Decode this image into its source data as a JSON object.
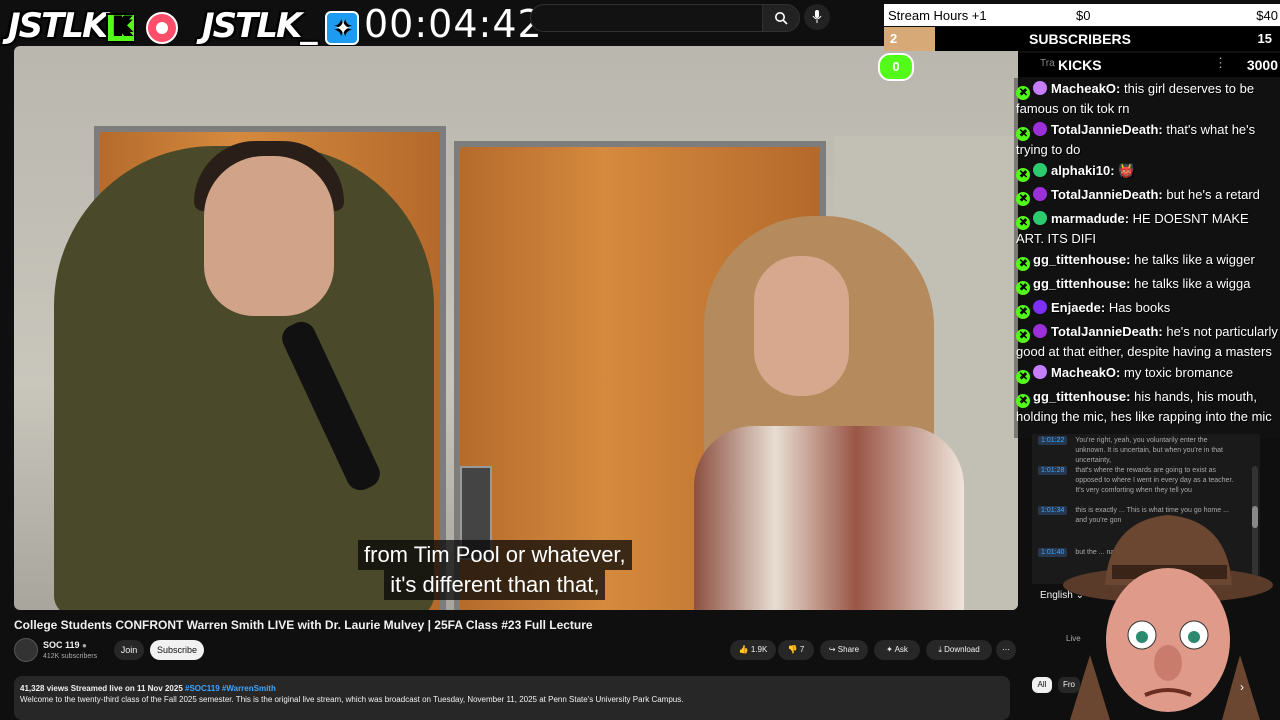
{
  "overlay": {
    "logo1": "JSTLK",
    "logo1_badge": "K",
    "logo2": "JSTLK_",
    "timer": "00:04:42",
    "stream_hours_label": "Stream Hours +1",
    "stream_hours_min": "$0",
    "stream_hours_max": "$40",
    "subs_current": "2",
    "subs_label": "SUBSCRIBERS",
    "subs_goal": "15",
    "subs_progress": 0.13,
    "kicks_current": "0",
    "kicks_label": "KICKS",
    "kicks_goal": "3000",
    "kicks_tab_hint": "Tra"
  },
  "chat": {
    "messages": [
      {
        "user": "MacheakO:",
        "text": "this girl deserves to be famous on tik tok rn",
        "badge_color": "#c77dff"
      },
      {
        "user": "TotalJannieDeath:",
        "text": "that's what he's trying to do",
        "badge_color": "#9b30d9"
      },
      {
        "user": "alphaki10:",
        "text": "👹",
        "badge_color": "#2ecc71"
      },
      {
        "user": "TotalJannieDeath:",
        "text": "but he's a retard",
        "badge_color": "#9b30d9"
      },
      {
        "user": "marmadude:",
        "text": "HE DOESNT MAKE ART. ITS DIFI",
        "badge_color": "#2ecc71"
      },
      {
        "user": "gg_tittenhouse:",
        "text": "he talks like a wigger",
        "badge_color": ""
      },
      {
        "user": "gg_tittenhouse:",
        "text": "he talks like a wigga",
        "badge_color": ""
      },
      {
        "user": "Enjaede:",
        "text": "Has books",
        "badge_color": "#7b2ff7"
      },
      {
        "user": "TotalJannieDeath:",
        "text": "he's not particularly good at that either, despite having a masters",
        "badge_color": "#9b30d9"
      },
      {
        "user": "MacheakO:",
        "text": "my toxic bromance",
        "badge_color": "#c77dff"
      },
      {
        "user": "gg_tittenhouse:",
        "text": "his hands, his mouth, holding the mic, hes like rapping into the mic",
        "badge_color": ""
      }
    ]
  },
  "transcript": {
    "lines": [
      {
        "time": "1:01:22",
        "text": "You're right, yeah, you voluntarily enter the unknown. It is uncertain, but when you're in that uncertainty,"
      },
      {
        "time": "1:01:28",
        "text": "that's where the rewards are going to exist as opposed to where I went in every day as a teacher. It's very comforting when they tell you"
      },
      {
        "time": "1:01:34",
        "text": "this is exactly ... This is what time you go home ... and you're gon"
      },
      {
        "time": "1:01:40",
        "text": "but the ... na"
      }
    ],
    "language": "English",
    "live_label": "Live"
  },
  "video": {
    "caption_line1": "from Tim Pool or whatever,",
    "caption_line2": "it's different than that,"
  },
  "page": {
    "title": "College Students CONFRONT Warren Smith LIVE with Dr. Laurie Mulvey | 25FA Class #23 Full Lecture",
    "channel_name": "SOC 119",
    "subscribers": "412K subscribers",
    "join_label": "Join",
    "subscribe_label": "Subscribe",
    "likes": "1.9K",
    "dislikes": "7",
    "share_label": "Share",
    "ask_label": "Ask",
    "download_label": "Download",
    "views_line": "41,328 views  Streamed live on 11 Nov 2025",
    "hashtags": "#SOC119 #WarrenSmith",
    "description": "Welcome to the twenty-third class of the Fall 2025 semester. This is the original live stream, which was broadcast on Tuesday, November 11, 2025 at Penn State's University Park Campus.",
    "chip_all": "All",
    "chip_from": "Fro"
  },
  "colors": {
    "kick_green": "#53fc18",
    "bg": "#0f0f0f",
    "subs_bar": "#d6a977"
  }
}
